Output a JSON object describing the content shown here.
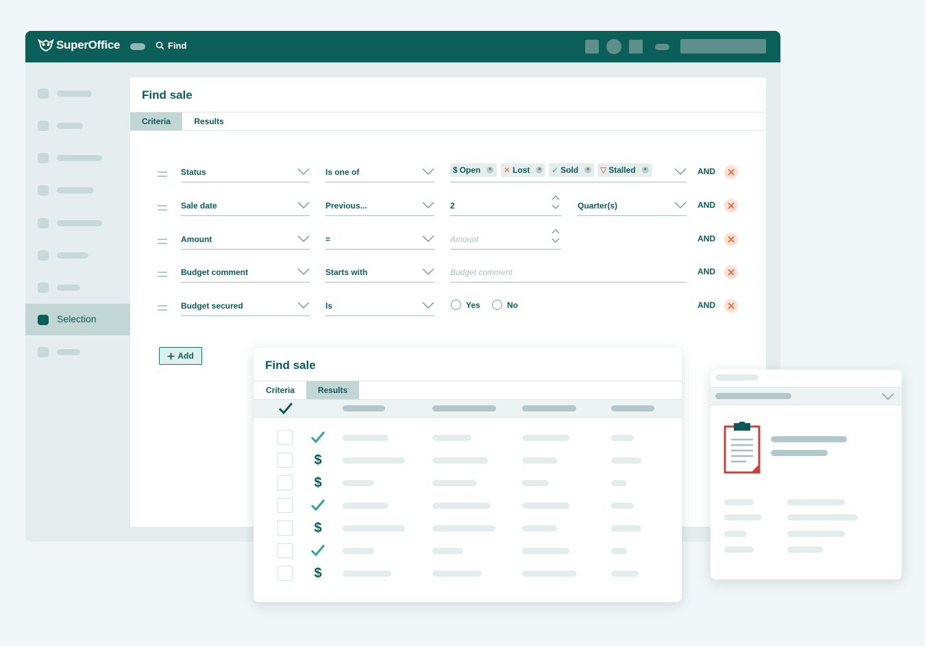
{
  "app": {
    "brand": "SuperOffice",
    "find_label": "Find"
  },
  "sidebar": {
    "selection_label": "Selection"
  },
  "find_panel": {
    "title": "Find sale",
    "tabs": [
      {
        "label": "Criteria",
        "active": true
      },
      {
        "label": "Results",
        "active": false
      }
    ],
    "rows": [
      {
        "field": "Status",
        "operator": "Is one of",
        "chips": [
          {
            "icon": "$",
            "label": "Open"
          },
          {
            "icon": "✕",
            "label": "Lost"
          },
          {
            "icon": "✓",
            "label": "Sold"
          },
          {
            "icon": "▽",
            "label": "Stalled"
          }
        ],
        "conj": "AND"
      },
      {
        "field": "Sale date",
        "operator": "Previous...",
        "value": "2",
        "unit": "Quarter(s)",
        "conj": "AND"
      },
      {
        "field": "Amount",
        "operator": "=",
        "placeholder": "Amount",
        "conj": "AND"
      },
      {
        "field": "Budget comment",
        "operator": "Starts with",
        "placeholder": "Budget comment",
        "conj": "AND"
      },
      {
        "field": "Budget secured",
        "operator": "Is",
        "options": [
          "Yes",
          "No"
        ],
        "conj": "AND"
      }
    ],
    "add_label": "Add"
  },
  "results_card": {
    "title": "Find sale",
    "tabs": [
      {
        "label": "Criteria",
        "active": false
      },
      {
        "label": "Results",
        "active": true
      }
    ],
    "row_icons": [
      "check",
      "dollar",
      "dollar",
      "check",
      "dollar",
      "check",
      "dollar"
    ]
  },
  "colors": {
    "brand": "#0c5f59",
    "accent_check": "#2fa58f",
    "remove_bg": "#fde1d6",
    "remove_fg": "#e8673a",
    "stalled": "#c8413a"
  }
}
